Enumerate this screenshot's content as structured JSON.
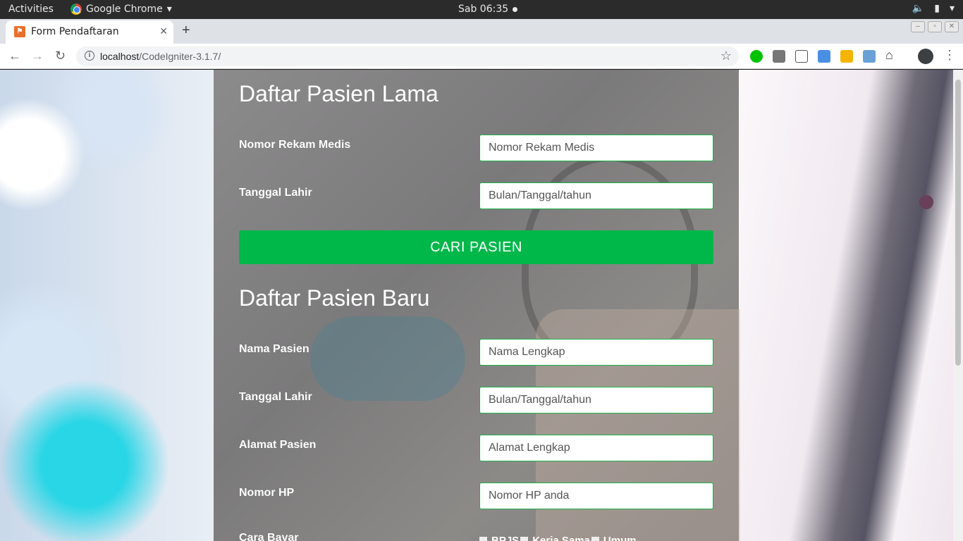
{
  "topbar": {
    "activities": "Activities",
    "app": "Google Chrome",
    "clock": "Sab 06:35"
  },
  "tab": {
    "title": "Form Pendaftaran"
  },
  "address": {
    "host": "localhost",
    "path": "/CodeIgniter-3.1.7/"
  },
  "old_patient": {
    "title": "Daftar Pasien Lama",
    "record_label": "Nomor Rekam Medis",
    "record_placeholder": "Nomor Rekam Medis",
    "dob_label": "Tanggal Lahir",
    "dob_placeholder": "Bulan/Tanggal/tahun",
    "search_button": "CARI PASIEN"
  },
  "new_patient": {
    "title": "Daftar Pasien Baru",
    "name_label": "Nama Pasien",
    "name_placeholder": "Nama Lengkap",
    "dob_label": "Tanggal Lahir",
    "dob_placeholder": "Bulan/Tanggal/tahun",
    "address_label": "Alamat Pasien",
    "address_placeholder": "Alamat Lengkap",
    "phone_label": "Nomor HP",
    "phone_placeholder": "Nomor HP anda",
    "payment_label": "Cara Bayar",
    "payment_options": [
      "BPJS",
      "Kerja Sama",
      "Umum"
    ]
  },
  "colors": {
    "accent_green": "#00b74a",
    "field_border": "#1fb24a"
  }
}
